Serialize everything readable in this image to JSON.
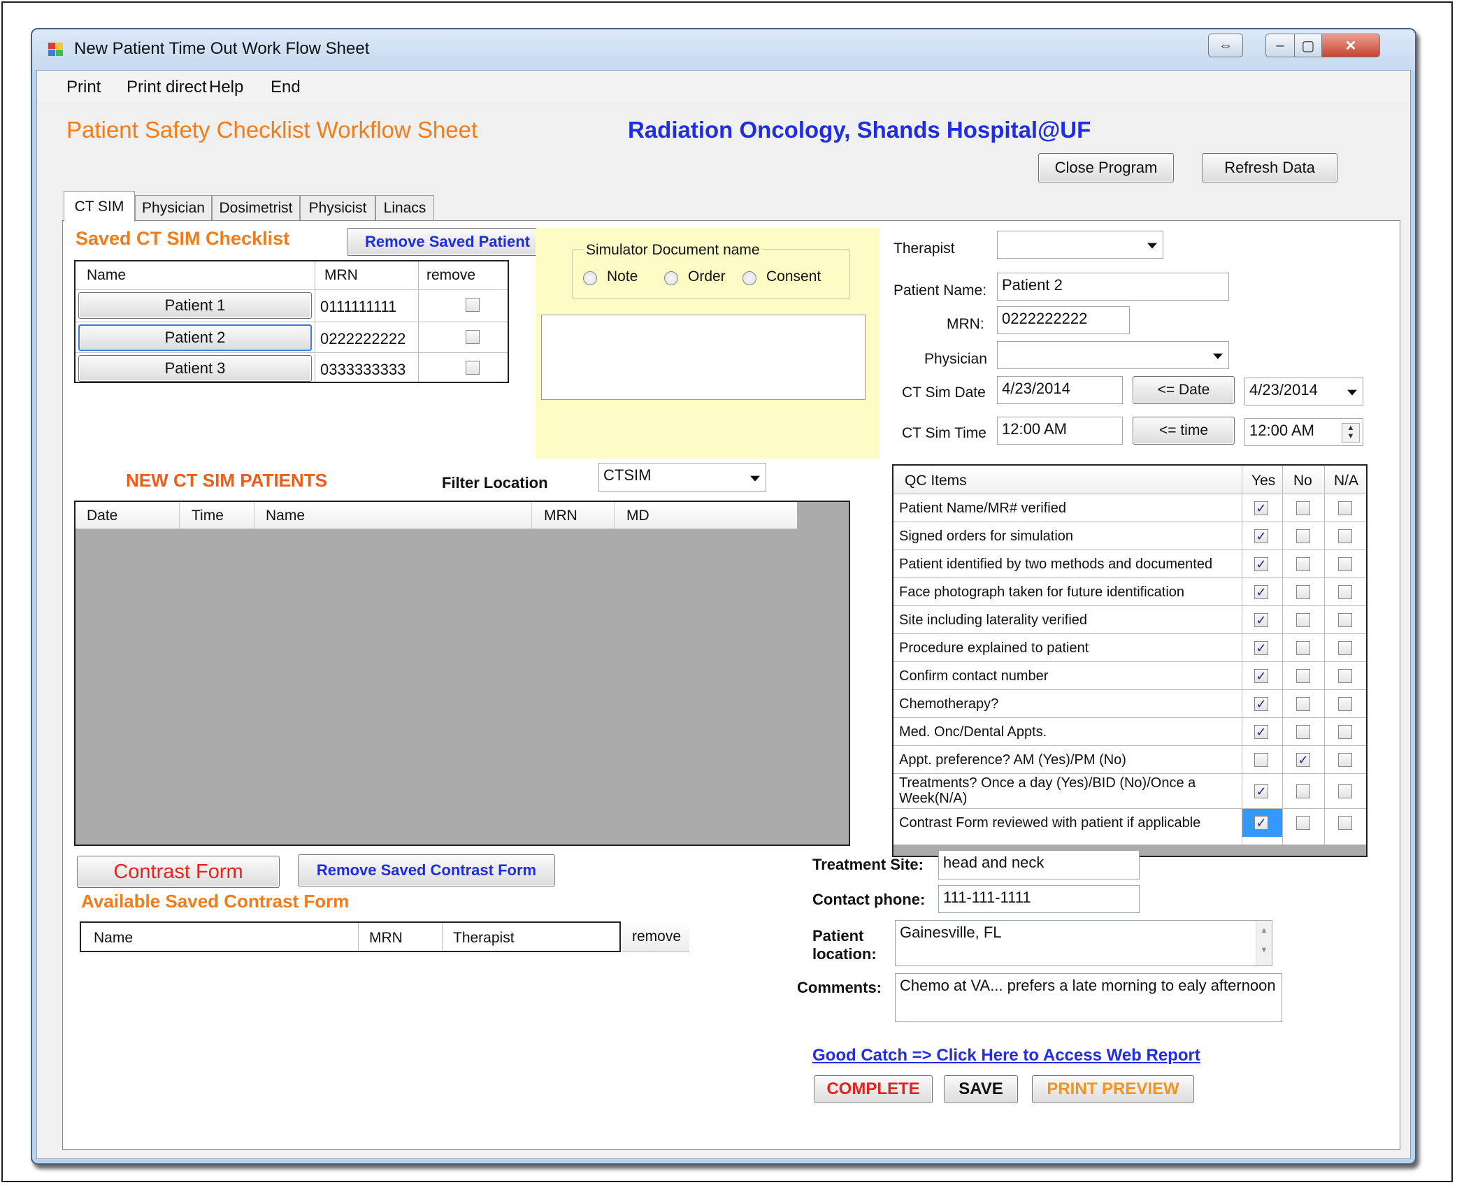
{
  "window": {
    "title": "New Patient Time Out Work Flow Sheet",
    "restore_glyph": "⇔",
    "minimize_glyph": "–",
    "maximize_glyph": "▢",
    "close_glyph": "✕"
  },
  "menu": [
    "Print",
    "Print direct",
    "Help",
    "End"
  ],
  "header": {
    "title": "Patient Safety Checklist Workflow Sheet",
    "org": "Radiation Oncology, Shands Hospital@UF",
    "close_program": "Close Program",
    "refresh_data": "Refresh Data"
  },
  "tabs": [
    "CT SIM",
    "Physician",
    "Dosimetrist",
    "Physicist",
    "Linacs"
  ],
  "saved_checklist": {
    "title": "Saved CT SIM Checklist",
    "remove_button": "Remove Saved Patient",
    "columns": [
      "Name",
      "MRN",
      "remove"
    ],
    "rows": [
      {
        "name": "Patient 1",
        "mrn": "0111111111"
      },
      {
        "name": "Patient 2",
        "mrn": "0222222222"
      },
      {
        "name": "Patient 3",
        "mrn": "0333333333"
      }
    ]
  },
  "simulator_doc": {
    "legend": "Simulator Document name",
    "options": [
      "Note",
      "Order",
      "Consent"
    ]
  },
  "patient_form": {
    "therapist_label": "Therapist",
    "therapist_value": "",
    "patient_name_label": "Patient Name:",
    "patient_name_value": "Patient 2",
    "mrn_label": "MRN:",
    "mrn_value": "0222222222",
    "physician_label": "Physician",
    "physician_value": "",
    "ct_sim_date_label": "CT Sim Date",
    "ct_sim_date_value": "4/23/2014",
    "date_button": "<= Date",
    "date_picker_value": "4/23/2014",
    "ct_sim_time_label": "CT Sim Time",
    "ct_sim_time_value": "12:00 AM",
    "time_button": "<= time",
    "time_picker_value": "12:00 AM"
  },
  "new_patients": {
    "title": "NEW CT SIM PATIENTS",
    "filter_label": "Filter Location",
    "filter_value": "CTSIM",
    "columns": [
      "Date",
      "Time",
      "Name",
      "MRN",
      "MD"
    ]
  },
  "qc": {
    "columns": [
      "QC Items",
      "Yes",
      "No",
      "N/A"
    ],
    "items": [
      {
        "text": "Patient Name/MR# verified",
        "yes": true,
        "no": false,
        "na": false
      },
      {
        "text": "Signed orders for simulation",
        "yes": true,
        "no": false,
        "na": false
      },
      {
        "text": "Patient identified by two methods and documented",
        "yes": true,
        "no": false,
        "na": false
      },
      {
        "text": "Face photograph taken for future identification",
        "yes": true,
        "no": false,
        "na": false
      },
      {
        "text": "Site including laterality verified",
        "yes": true,
        "no": false,
        "na": false
      },
      {
        "text": "Procedure explained to patient",
        "yes": true,
        "no": false,
        "na": false
      },
      {
        "text": "Confirm contact number",
        "yes": true,
        "no": false,
        "na": false
      },
      {
        "text": "Chemotherapy?",
        "yes": true,
        "no": false,
        "na": false
      },
      {
        "text": "Med. Onc/Dental Appts.",
        "yes": true,
        "no": false,
        "na": false
      },
      {
        "text": "Appt. preference? AM (Yes)/PM (No)",
        "yes": false,
        "no": true,
        "na": false
      },
      {
        "text": "Treatments? Once a day (Yes)/BID (No)/Once a Week(N/A)",
        "yes": true,
        "no": false,
        "na": false
      },
      {
        "text": "Contrast Form reviewed with patient if applicable",
        "yes": true,
        "no": false,
        "na": false
      }
    ]
  },
  "contrast": {
    "contrast_form_button": "Contrast Form",
    "remove_contrast_button": "Remove Saved Contrast Form",
    "available_title": "Available Saved Contrast Form",
    "columns": [
      "Name",
      "MRN",
      "Therapist"
    ],
    "remove_col": "remove"
  },
  "details": {
    "treatment_site_label": "Treatment Site:",
    "treatment_site_value": "head and neck",
    "contact_phone_label": "Contact phone:",
    "contact_phone_value": "111-111-1111",
    "patient_location_label_1": "Patient",
    "patient_location_label_2": "location:",
    "patient_location_value": "Gainesville, FL",
    "comments_label": "Comments:",
    "comments_value": "Chemo at VA... prefers a late morning to ealy afternoon"
  },
  "footer": {
    "good_catch_link": "Good Catch => Click Here to Access Web Report",
    "complete": "COMPLETE",
    "save": "SAVE",
    "print_preview": "PRINT PREVIEW"
  },
  "colors": {
    "orange": "#f27c1a",
    "blue": "#1f2ee0",
    "red": "#e8231d",
    "yellow_panel": "#fdfcc4",
    "grid_gray": "#ababab"
  }
}
